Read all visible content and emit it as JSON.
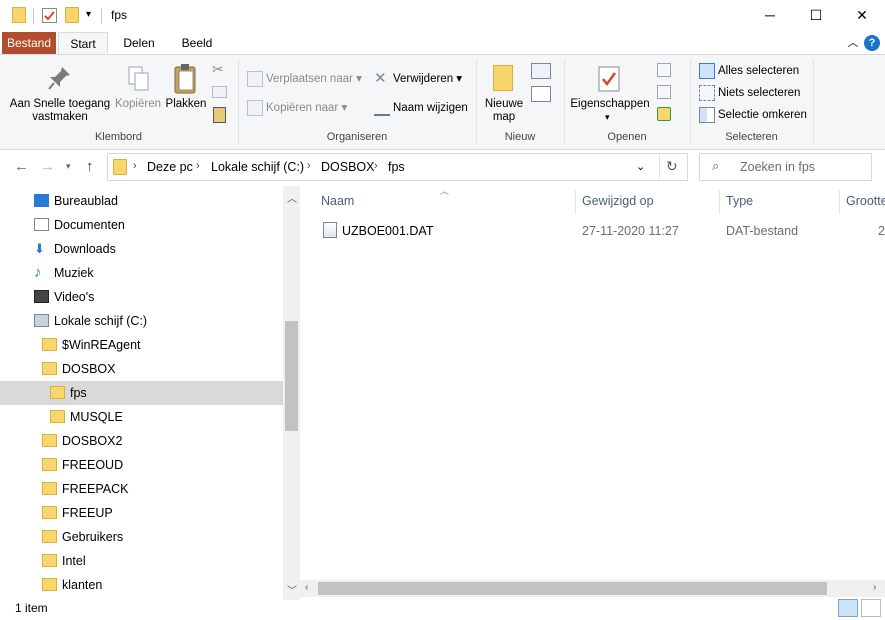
{
  "window": {
    "title": "fps"
  },
  "ribbon_tabs": [
    "Bestand",
    "Start",
    "Delen",
    "Beeld"
  ],
  "ribbon": {
    "klembord": {
      "pin_label": "Aan Snelle toegang vastmaken",
      "copy_label": "Kopiëren",
      "paste_label": "Plakken",
      "group": "Klembord"
    },
    "organiseren": {
      "move_label": "Verplaatsen naar",
      "copyto_label": "Kopiëren naar",
      "delete_label": "Verwijderen",
      "rename_label": "Naam wijzigen",
      "group": "Organiseren"
    },
    "nieuw": {
      "newfolder_label": "Nieuwe map",
      "group": "Nieuw"
    },
    "openen": {
      "properties_label": "Eigenschappen",
      "group": "Openen"
    },
    "selecteren": {
      "all_label": "Alles selecteren",
      "none_label": "Niets selecteren",
      "invert_label": "Selectie omkeren",
      "group": "Selecteren"
    }
  },
  "address": {
    "crumbs": [
      "Deze pc",
      "Lokale schijf (C:)",
      "DOSBOX",
      "fps"
    ],
    "search_placeholder": "Zoeken in fps"
  },
  "nav_items": [
    {
      "label": "Bureaublad",
      "icon": "desktop-icon"
    },
    {
      "label": "Documenten",
      "icon": "documents-icon"
    },
    {
      "label": "Downloads",
      "icon": "downloads-icon"
    },
    {
      "label": "Muziek",
      "icon": "music-icon"
    },
    {
      "label": "Video's",
      "icon": "videos-icon"
    },
    {
      "label": "Lokale schijf (C:)",
      "icon": "drive-icon"
    },
    {
      "label": "$WinREAgent",
      "icon": "folder-icon"
    },
    {
      "label": "DOSBOX",
      "icon": "folder-icon"
    },
    {
      "label": "fps",
      "icon": "folder-icon",
      "selected": true
    },
    {
      "label": "MUSQLE",
      "icon": "folder-icon"
    },
    {
      "label": "DOSBOX2",
      "icon": "folder-icon"
    },
    {
      "label": "FREEOUD",
      "icon": "folder-icon"
    },
    {
      "label": "FREEPACK",
      "icon": "folder-icon"
    },
    {
      "label": "FREEUP",
      "icon": "folder-icon"
    },
    {
      "label": "Gebruikers",
      "icon": "folder-icon"
    },
    {
      "label": "Intel",
      "icon": "folder-icon"
    },
    {
      "label": "klanten",
      "icon": "folder-icon"
    }
  ],
  "columns": [
    "Naam",
    "Gewijzigd op",
    "Type",
    "Grootte"
  ],
  "files": [
    {
      "name": "UZBOE001.DAT",
      "modified": "27-11-2020 11:27",
      "type": "DAT-bestand",
      "size": "2"
    }
  ],
  "status": {
    "count": "1 item"
  },
  "colors": {
    "accent": "#b24d2d",
    "selected": "#d9d9d9",
    "folder": "#f9d66b",
    "header_text": "#4c607a"
  }
}
